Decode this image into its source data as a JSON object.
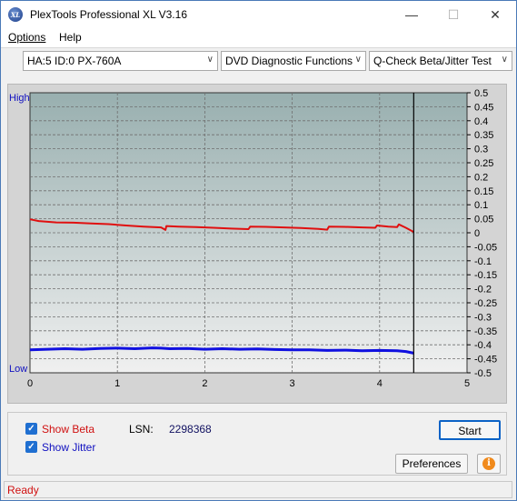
{
  "window": {
    "title": "PlexTools Professional XL V3.16",
    "icon_text": "XL",
    "minimize_glyph": "—",
    "maximize_glyph": "☐",
    "close_glyph": "✕"
  },
  "menu": {
    "options": "Options",
    "help": "Help"
  },
  "toolbar": {
    "drive": "HA:5 ID:0  PX-760A",
    "function": "DVD Diagnostic Functions",
    "test": "Q-Check Beta/Jitter Test",
    "arrow_glyph": "∨"
  },
  "chart_data": {
    "type": "line",
    "left_axis_labels": {
      "top": "High",
      "bottom": "Low"
    },
    "x_ticks": [
      "0",
      "1",
      "2",
      "3",
      "4",
      "5"
    ],
    "xlim": [
      0,
      5
    ],
    "ylim": [
      -0.5,
      0.5
    ],
    "y_ticks": [
      "0.5",
      "0.45",
      "0.4",
      "0.35",
      "0.3",
      "0.25",
      "0.2",
      "0.15",
      "0.1",
      "0.05",
      "0",
      "-0.05",
      "-0.1",
      "-0.15",
      "-0.2",
      "-0.25",
      "-0.3",
      "-0.35",
      "-0.4",
      "-0.45",
      "-0.5"
    ],
    "end_marker_x": 4.39,
    "grid": true,
    "colors": {
      "beta": "#e01010",
      "jitter": "#1010e0",
      "plot_top": "#98afaf",
      "plot_bottom": "#f0f0f0",
      "frame": "#d4d4d4"
    },
    "series": [
      {
        "key": "beta",
        "points": [
          [
            0,
            0.048
          ],
          [
            0.1,
            0.042
          ],
          [
            0.3,
            0.037
          ],
          [
            0.5,
            0.036
          ],
          [
            0.7,
            0.033
          ],
          [
            0.9,
            0.031
          ],
          [
            1.1,
            0.026
          ],
          [
            1.3,
            0.022
          ],
          [
            1.5,
            0.019
          ],
          [
            1.55,
            0.01
          ],
          [
            1.56,
            0.024
          ],
          [
            1.7,
            0.022
          ],
          [
            1.9,
            0.02
          ],
          [
            2.1,
            0.018
          ],
          [
            2.3,
            0.015
          ],
          [
            2.5,
            0.013
          ],
          [
            2.52,
            0.022
          ],
          [
            2.7,
            0.021
          ],
          [
            2.9,
            0.019
          ],
          [
            3.1,
            0.017
          ],
          [
            3.3,
            0.014
          ],
          [
            3.4,
            0.011
          ],
          [
            3.42,
            0.022
          ],
          [
            3.6,
            0.021
          ],
          [
            3.8,
            0.019
          ],
          [
            3.95,
            0.018
          ],
          [
            3.97,
            0.026
          ],
          [
            4.1,
            0.022
          ],
          [
            4.2,
            0.02
          ],
          [
            4.22,
            0.03
          ],
          [
            4.3,
            0.018
          ],
          [
            4.39,
            0.003
          ]
        ]
      },
      {
        "key": "jitter",
        "points": [
          [
            0,
            -0.418
          ],
          [
            0.2,
            -0.416
          ],
          [
            0.4,
            -0.414
          ],
          [
            0.6,
            -0.416
          ],
          [
            0.8,
            -0.413
          ],
          [
            1.0,
            -0.412
          ],
          [
            1.2,
            -0.414
          ],
          [
            1.4,
            -0.411
          ],
          [
            1.5,
            -0.412
          ],
          [
            1.6,
            -0.414
          ],
          [
            1.8,
            -0.413
          ],
          [
            2.0,
            -0.416
          ],
          [
            2.2,
            -0.414
          ],
          [
            2.4,
            -0.416
          ],
          [
            2.6,
            -0.415
          ],
          [
            2.8,
            -0.417
          ],
          [
            3.0,
            -0.418
          ],
          [
            3.2,
            -0.418
          ],
          [
            3.4,
            -0.42
          ],
          [
            3.6,
            -0.419
          ],
          [
            3.8,
            -0.421
          ],
          [
            4.0,
            -0.42
          ],
          [
            4.2,
            -0.421
          ],
          [
            4.3,
            -0.424
          ],
          [
            4.39,
            -0.43
          ]
        ]
      }
    ]
  },
  "controls": {
    "show_beta": "Show Beta",
    "show_jitter": "Show Jitter",
    "checkmark": "✓",
    "lsn_label": "LSN:",
    "lsn_value": "2298368",
    "start": "Start",
    "preferences": "Preferences",
    "info_glyph": "i"
  },
  "status": {
    "text": "Ready"
  }
}
